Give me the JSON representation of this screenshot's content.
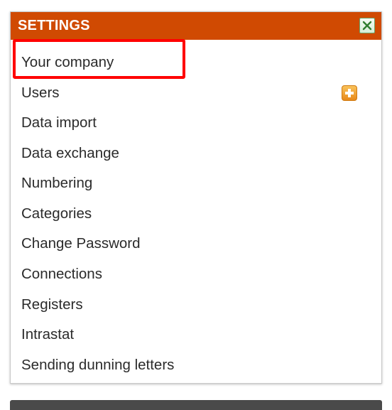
{
  "panel": {
    "title": "SETTINGS",
    "header_color": "#d04a02",
    "close_icon": "close-icon",
    "highlight_color": "#ff0000"
  },
  "menu": {
    "items": [
      {
        "label": "Your company",
        "highlighted": true
      },
      {
        "label": "Users",
        "action_icon": "add-icon"
      },
      {
        "label": "Data import"
      },
      {
        "label": "Data exchange"
      },
      {
        "label": "Numbering"
      },
      {
        "label": "Categories"
      },
      {
        "label": "Change Password"
      },
      {
        "label": "Connections"
      },
      {
        "label": "Registers"
      },
      {
        "label": "Intrastat"
      },
      {
        "label": "Sending dunning letters"
      }
    ]
  }
}
